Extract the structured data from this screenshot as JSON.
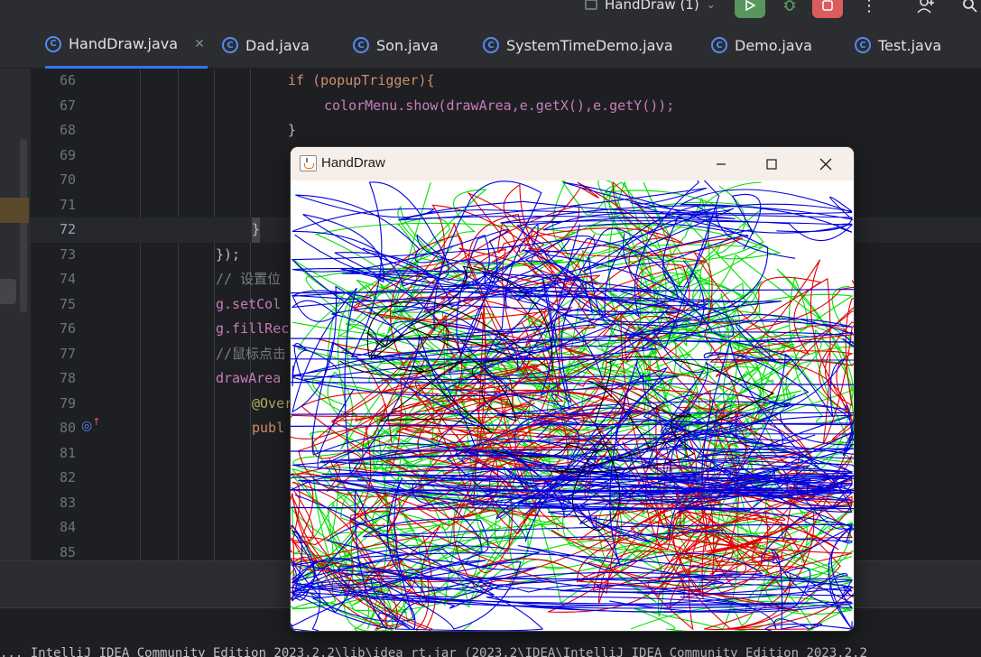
{
  "toolbar": {
    "run_config_label": "HandDraw (1)"
  },
  "tabs": [
    {
      "label": "HandDraw.java",
      "active": true,
      "close": "✕"
    },
    {
      "label": "Dad.java"
    },
    {
      "label": "Son.java"
    },
    {
      "label": "SystemTimeDemo.java"
    },
    {
      "label": "Demo.java"
    },
    {
      "label": "Test.java"
    }
  ],
  "editor": {
    "current_line": 72,
    "lines": [
      {
        "num": "66",
        "text": "if (popupTrigger){"
      },
      {
        "num": "67",
        "text": "colorMenu.show(drawArea,e.getX(),e.getY());"
      },
      {
        "num": "68",
        "text": "}"
      },
      {
        "num": "69",
        "text": ""
      },
      {
        "num": "70",
        "text": ""
      },
      {
        "num": "71",
        "text": ""
      },
      {
        "num": "72",
        "text": "}"
      },
      {
        "num": "73",
        "text": "});"
      },
      {
        "num": "74",
        "text": "// 设置位"
      },
      {
        "num": "75",
        "text": "g.setCol"
      },
      {
        "num": "76",
        "text": "g.fillRec"
      },
      {
        "num": "77",
        "text": "//鼠标点击"
      },
      {
        "num": "78",
        "text": "drawArea"
      },
      {
        "num": "79",
        "text": "@Over"
      },
      {
        "num": "80",
        "text": "publ"
      },
      {
        "num": "81",
        "text": ""
      },
      {
        "num": "82",
        "text": ""
      },
      {
        "num": "83",
        "text": ""
      },
      {
        "num": "84",
        "text": ""
      },
      {
        "num": "85",
        "text": ""
      }
    ]
  },
  "window": {
    "title": "HandDraw",
    "scribble_colors": [
      "#00e000",
      "#e00000",
      "#0000e0",
      "#000000"
    ]
  },
  "console": {
    "text": "... IntelliJ IDEA Community Edition 2023.2.2\\lib\\idea_rt.jar (2023.2\\IDEA\\IntelliJ IDEA Community Edition 2023.2.2"
  }
}
